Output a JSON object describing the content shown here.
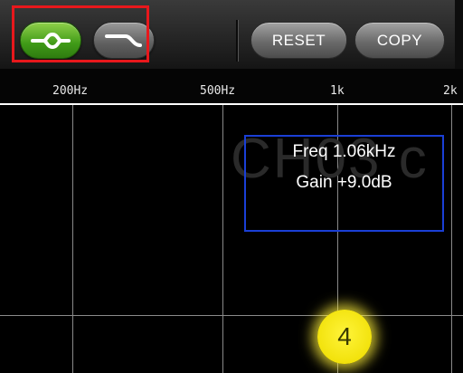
{
  "toolbar": {
    "filter_types": [
      {
        "icon": "bell-filter-icon",
        "selected": true,
        "color": "#3f9a17"
      },
      {
        "icon": "shelf-filter-icon",
        "selected": false,
        "color": "#6a6a6a"
      }
    ],
    "reset_label": "RESET",
    "copy_label": "COPY",
    "highlight_color": "#e8181c"
  },
  "freq_axis": {
    "labels": [
      "200Hz",
      "500Hz",
      "1k",
      "2k"
    ]
  },
  "eq": {
    "watermark": "CH03 c",
    "freq_text": "Freq  1.06kHz",
    "gain_text": "Gain +9.0dB",
    "readout_border_color": "#1a3fd6",
    "band_number": "4",
    "band_color": "#f2e20c"
  }
}
